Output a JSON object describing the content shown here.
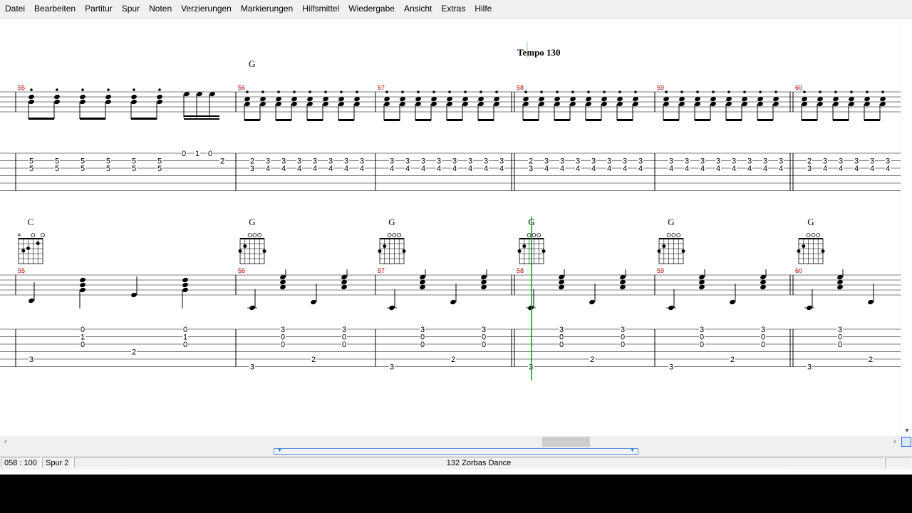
{
  "menu": [
    "Datei",
    "Bearbeiten",
    "Partitur",
    "Spur",
    "Noten",
    "Verzierungen",
    "Markierungen",
    "Hilfsmittel",
    "Wiedergabe",
    "Ansicht",
    "Extras",
    "Hilfe"
  ],
  "tempo_label": "Tempo 130",
  "upper_system": {
    "chord_above": "G",
    "measure_numbers": [
      "55",
      "56",
      "57",
      "58",
      "59",
      "60"
    ],
    "tab_m55": [
      {
        "t": "5",
        "b": "5"
      },
      {
        "t": "5",
        "b": "5"
      },
      {
        "t": "5",
        "b": "5"
      },
      {
        "t": "5",
        "b": "5"
      },
      {
        "t": "5",
        "b": "5"
      },
      {
        "t": "5",
        "b": "5"
      }
    ],
    "tab_m55_grace": [
      "0",
      "1",
      "0",
      "2"
    ],
    "tab_pattern_first": {
      "t": "2",
      "b": "3"
    },
    "tab_pattern_pair": {
      "t": "3",
      "b": "4"
    }
  },
  "lower_system": {
    "chords": [
      "C",
      "G",
      "G",
      "G",
      "G",
      "G"
    ],
    "measure_numbers": [
      "55",
      "56",
      "57",
      "58",
      "59",
      "60"
    ],
    "tab_c_chord": [
      "0",
      "1",
      "0"
    ],
    "tab_c_bass": [
      "3",
      "2"
    ],
    "tab_g_chord": [
      "3",
      "0",
      "0"
    ],
    "tab_g_bass": [
      "3",
      "2"
    ]
  },
  "status": {
    "position": "058 : 100",
    "track": "Spur 2",
    "song": "132 Zorbas Dance"
  },
  "colors": {
    "measure_number": "#c00000",
    "cursor": "#00a000",
    "chrome": "#f0f0f0"
  }
}
